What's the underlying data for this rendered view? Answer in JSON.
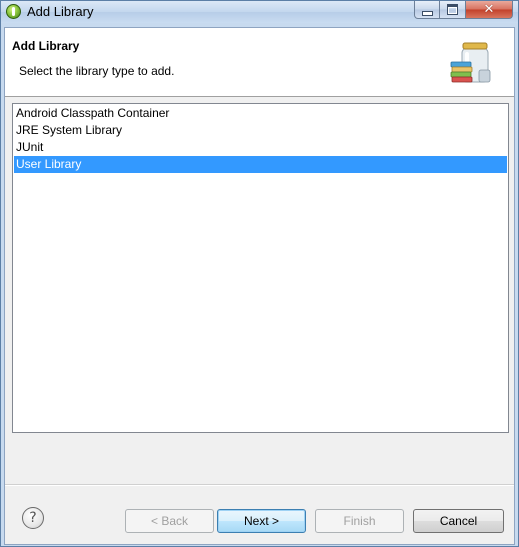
{
  "window": {
    "title": "Add Library",
    "close_glyph": "✕"
  },
  "banner": {
    "title": "Add Library",
    "description": "Select the library type to add.",
    "icon": "library-jar-icon"
  },
  "library_types": {
    "items": [
      {
        "label": "Android Classpath Container",
        "selected": false
      },
      {
        "label": "JRE System Library",
        "selected": false
      },
      {
        "label": "JUnit",
        "selected": false
      },
      {
        "label": "User Library",
        "selected": true
      }
    ]
  },
  "footer": {
    "help_glyph": "?",
    "back_label": "< Back",
    "next_label": "Next >",
    "finish_label": "Finish",
    "cancel_label": "Cancel"
  },
  "colors": {
    "selection": "#3399ff",
    "default_button_border": "#3c7fb1"
  }
}
